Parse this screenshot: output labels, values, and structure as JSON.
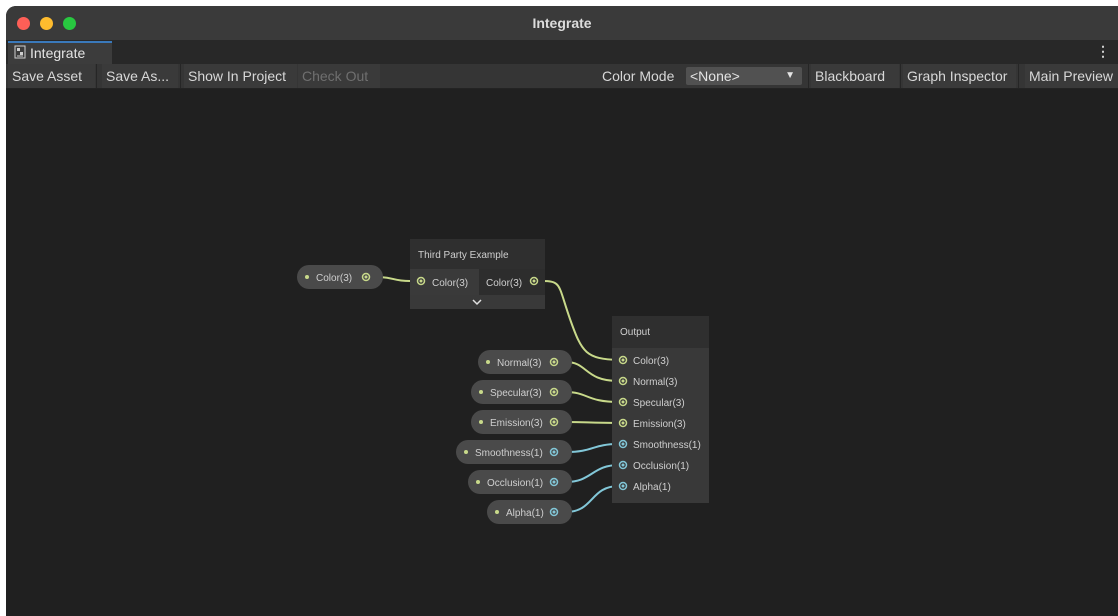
{
  "window": {
    "title": "Integrate"
  },
  "tab": {
    "label": "Integrate"
  },
  "toolbar": {
    "save_asset": "Save Asset",
    "save_as": "Save As...",
    "show_in_project": "Show In Project",
    "check_out": "Check Out",
    "color_mode_label": "Color Mode",
    "color_mode_value": "<None>",
    "blackboard": "Blackboard",
    "graph_inspector": "Graph Inspector",
    "main_preview": "Main Preview"
  },
  "graph": {
    "input_color": "Color(3)",
    "third_party": {
      "title": "Third Party Example",
      "input": "Color(3)",
      "output": "Color(3)"
    },
    "output": {
      "title": "Output",
      "ports": [
        "Color(3)",
        "Normal(3)",
        "Specular(3)",
        "Emission(3)",
        "Smoothness(1)",
        "Occlusion(1)",
        "Alpha(1)"
      ]
    },
    "inputs": [
      "Normal(3)",
      "Specular(3)",
      "Emission(3)",
      "Smoothness(1)",
      "Occlusion(1)",
      "Alpha(1)"
    ]
  },
  "colors": {
    "vector3": "#c8d98a",
    "vector1": "#82c7d8",
    "node_body": "#393939",
    "node_header": "#2f2f2f"
  }
}
